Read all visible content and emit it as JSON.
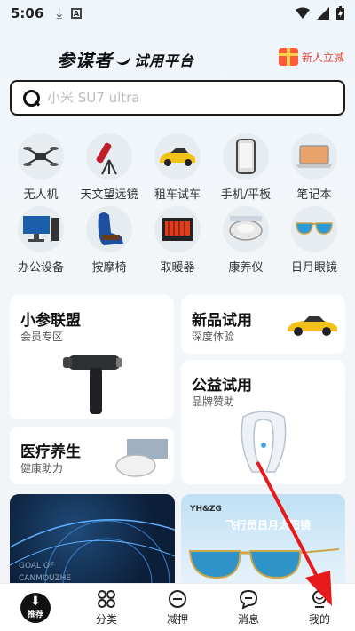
{
  "status_bar": {
    "time": "5:06"
  },
  "header": {
    "logo_main": "参谋者",
    "logo_sub": "试用平台",
    "newbie_label": "新人立减"
  },
  "search": {
    "placeholder": "小米 SU7 ultra"
  },
  "categories": [
    {
      "label": "无人机",
      "icon": "drone-icon"
    },
    {
      "label": "天文望远镜",
      "icon": "telescope-icon"
    },
    {
      "label": "租车试车",
      "icon": "car-icon"
    },
    {
      "label": "手机/平板",
      "icon": "phone-icon"
    },
    {
      "label": "笔记本",
      "icon": "laptop-icon"
    },
    {
      "label": "办公设备",
      "icon": "desktop-icon"
    },
    {
      "label": "按摩椅",
      "icon": "massage-chair-icon"
    },
    {
      "label": "取暖器",
      "icon": "heater-icon"
    },
    {
      "label": "康养仪",
      "icon": "neck-massager-icon"
    },
    {
      "label": "日月眼镜",
      "icon": "glasses-icon"
    }
  ],
  "cards": {
    "league": {
      "title": "小参联盟",
      "subtitle": "会员专区"
    },
    "new_trial": {
      "title": "新品试用",
      "subtitle": "深度体验"
    },
    "charity": {
      "title": "公益试用",
      "subtitle": "品牌赞助"
    },
    "health": {
      "title": "医疗养生",
      "subtitle": "健康助力"
    }
  },
  "promos": {
    "left": {
      "caption_line1": "GOAL OF",
      "caption_line2": "CANMOUZHE"
    },
    "right": {
      "brand": "YH&ZG",
      "caption": "飞行员日月太阳镜"
    }
  },
  "tabbar": [
    {
      "label": "推荐",
      "icon": "download-icon"
    },
    {
      "label": "分类",
      "icon": "category-icon"
    },
    {
      "label": "减押",
      "icon": "minus-circle-icon"
    },
    {
      "label": "消息",
      "icon": "message-icon"
    },
    {
      "label": "我的",
      "icon": "profile-icon"
    }
  ],
  "colors": {
    "accent_red": "#e2463a",
    "arrow_red": "#e8191a",
    "text_dark": "#111111"
  }
}
